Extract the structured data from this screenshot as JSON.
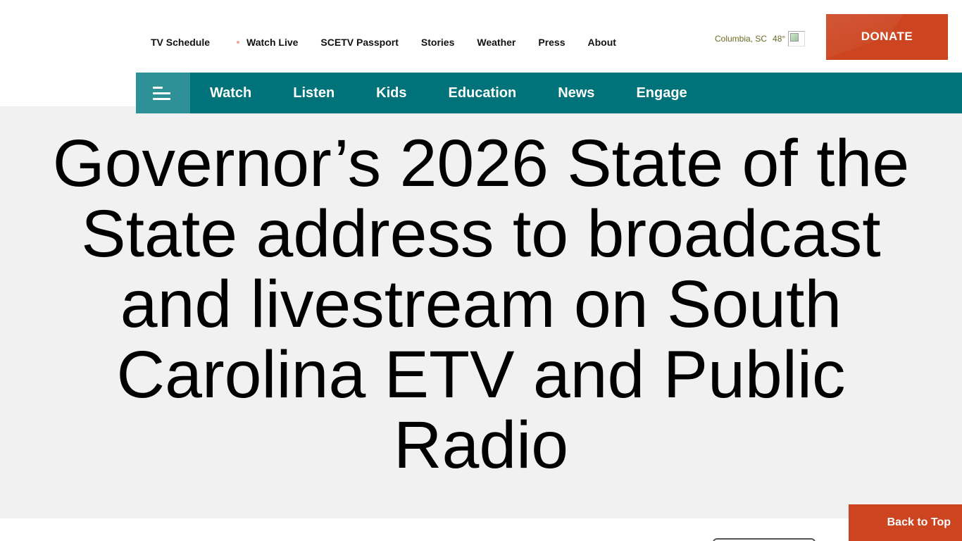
{
  "utility_nav": {
    "items": [
      {
        "label": "TV Schedule"
      },
      {
        "label": "Watch Live"
      },
      {
        "label": "SCETV Passport"
      },
      {
        "label": "Stories"
      },
      {
        "label": "Weather"
      },
      {
        "label": "Press"
      },
      {
        "label": "About"
      }
    ]
  },
  "weather": {
    "location": "Columbia, SC",
    "temperature": "48°"
  },
  "donate_label": "DONATE",
  "main_nav": {
    "items": [
      {
        "label": "Watch"
      },
      {
        "label": "Listen"
      },
      {
        "label": "Kids"
      },
      {
        "label": "Education"
      },
      {
        "label": "News"
      },
      {
        "label": "Engage"
      }
    ]
  },
  "headline": "Governor’s 2026 State of the State address to broadcast and livestream on South Carolina ETV and Public Radio",
  "back_to_top_label": "Back to Top",
  "colors": {
    "brand_teal": "#00737a",
    "teal_light": "#2e9198",
    "accent_orange": "#cc4420",
    "hero_gray": "#f1f1f1"
  }
}
